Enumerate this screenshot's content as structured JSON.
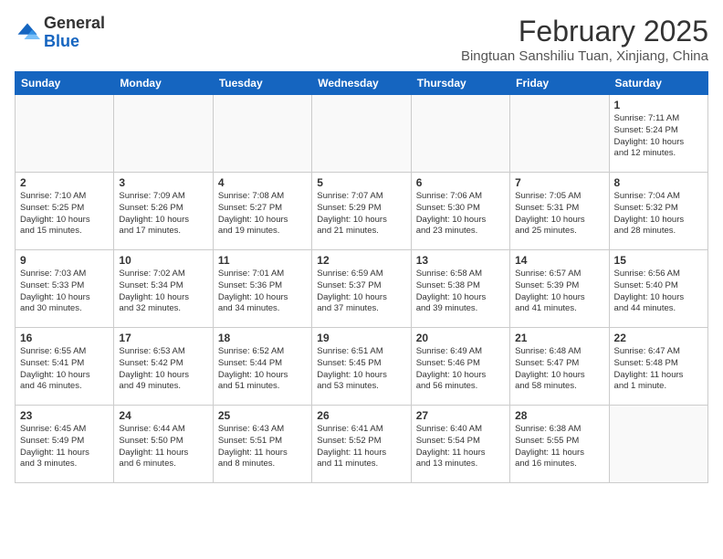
{
  "header": {
    "logo_general": "General",
    "logo_blue": "Blue",
    "month_title": "February 2025",
    "subtitle": "Bingtuan Sanshiliu Tuan, Xinjiang, China"
  },
  "weekdays": [
    "Sunday",
    "Monday",
    "Tuesday",
    "Wednesday",
    "Thursday",
    "Friday",
    "Saturday"
  ],
  "weeks": [
    [
      {
        "day": "",
        "info": ""
      },
      {
        "day": "",
        "info": ""
      },
      {
        "day": "",
        "info": ""
      },
      {
        "day": "",
        "info": ""
      },
      {
        "day": "",
        "info": ""
      },
      {
        "day": "",
        "info": ""
      },
      {
        "day": "1",
        "info": "Sunrise: 7:11 AM\nSunset: 5:24 PM\nDaylight: 10 hours\nand 12 minutes."
      }
    ],
    [
      {
        "day": "2",
        "info": "Sunrise: 7:10 AM\nSunset: 5:25 PM\nDaylight: 10 hours\nand 15 minutes."
      },
      {
        "day": "3",
        "info": "Sunrise: 7:09 AM\nSunset: 5:26 PM\nDaylight: 10 hours\nand 17 minutes."
      },
      {
        "day": "4",
        "info": "Sunrise: 7:08 AM\nSunset: 5:27 PM\nDaylight: 10 hours\nand 19 minutes."
      },
      {
        "day": "5",
        "info": "Sunrise: 7:07 AM\nSunset: 5:29 PM\nDaylight: 10 hours\nand 21 minutes."
      },
      {
        "day": "6",
        "info": "Sunrise: 7:06 AM\nSunset: 5:30 PM\nDaylight: 10 hours\nand 23 minutes."
      },
      {
        "day": "7",
        "info": "Sunrise: 7:05 AM\nSunset: 5:31 PM\nDaylight: 10 hours\nand 25 minutes."
      },
      {
        "day": "8",
        "info": "Sunrise: 7:04 AM\nSunset: 5:32 PM\nDaylight: 10 hours\nand 28 minutes."
      }
    ],
    [
      {
        "day": "9",
        "info": "Sunrise: 7:03 AM\nSunset: 5:33 PM\nDaylight: 10 hours\nand 30 minutes."
      },
      {
        "day": "10",
        "info": "Sunrise: 7:02 AM\nSunset: 5:34 PM\nDaylight: 10 hours\nand 32 minutes."
      },
      {
        "day": "11",
        "info": "Sunrise: 7:01 AM\nSunset: 5:36 PM\nDaylight: 10 hours\nand 34 minutes."
      },
      {
        "day": "12",
        "info": "Sunrise: 6:59 AM\nSunset: 5:37 PM\nDaylight: 10 hours\nand 37 minutes."
      },
      {
        "day": "13",
        "info": "Sunrise: 6:58 AM\nSunset: 5:38 PM\nDaylight: 10 hours\nand 39 minutes."
      },
      {
        "day": "14",
        "info": "Sunrise: 6:57 AM\nSunset: 5:39 PM\nDaylight: 10 hours\nand 41 minutes."
      },
      {
        "day": "15",
        "info": "Sunrise: 6:56 AM\nSunset: 5:40 PM\nDaylight: 10 hours\nand 44 minutes."
      }
    ],
    [
      {
        "day": "16",
        "info": "Sunrise: 6:55 AM\nSunset: 5:41 PM\nDaylight: 10 hours\nand 46 minutes."
      },
      {
        "day": "17",
        "info": "Sunrise: 6:53 AM\nSunset: 5:42 PM\nDaylight: 10 hours\nand 49 minutes."
      },
      {
        "day": "18",
        "info": "Sunrise: 6:52 AM\nSunset: 5:44 PM\nDaylight: 10 hours\nand 51 minutes."
      },
      {
        "day": "19",
        "info": "Sunrise: 6:51 AM\nSunset: 5:45 PM\nDaylight: 10 hours\nand 53 minutes."
      },
      {
        "day": "20",
        "info": "Sunrise: 6:49 AM\nSunset: 5:46 PM\nDaylight: 10 hours\nand 56 minutes."
      },
      {
        "day": "21",
        "info": "Sunrise: 6:48 AM\nSunset: 5:47 PM\nDaylight: 10 hours\nand 58 minutes."
      },
      {
        "day": "22",
        "info": "Sunrise: 6:47 AM\nSunset: 5:48 PM\nDaylight: 11 hours\nand 1 minute."
      }
    ],
    [
      {
        "day": "23",
        "info": "Sunrise: 6:45 AM\nSunset: 5:49 PM\nDaylight: 11 hours\nand 3 minutes."
      },
      {
        "day": "24",
        "info": "Sunrise: 6:44 AM\nSunset: 5:50 PM\nDaylight: 11 hours\nand 6 minutes."
      },
      {
        "day": "25",
        "info": "Sunrise: 6:43 AM\nSunset: 5:51 PM\nDaylight: 11 hours\nand 8 minutes."
      },
      {
        "day": "26",
        "info": "Sunrise: 6:41 AM\nSunset: 5:52 PM\nDaylight: 11 hours\nand 11 minutes."
      },
      {
        "day": "27",
        "info": "Sunrise: 6:40 AM\nSunset: 5:54 PM\nDaylight: 11 hours\nand 13 minutes."
      },
      {
        "day": "28",
        "info": "Sunrise: 6:38 AM\nSunset: 5:55 PM\nDaylight: 11 hours\nand 16 minutes."
      },
      {
        "day": "",
        "info": ""
      }
    ]
  ]
}
